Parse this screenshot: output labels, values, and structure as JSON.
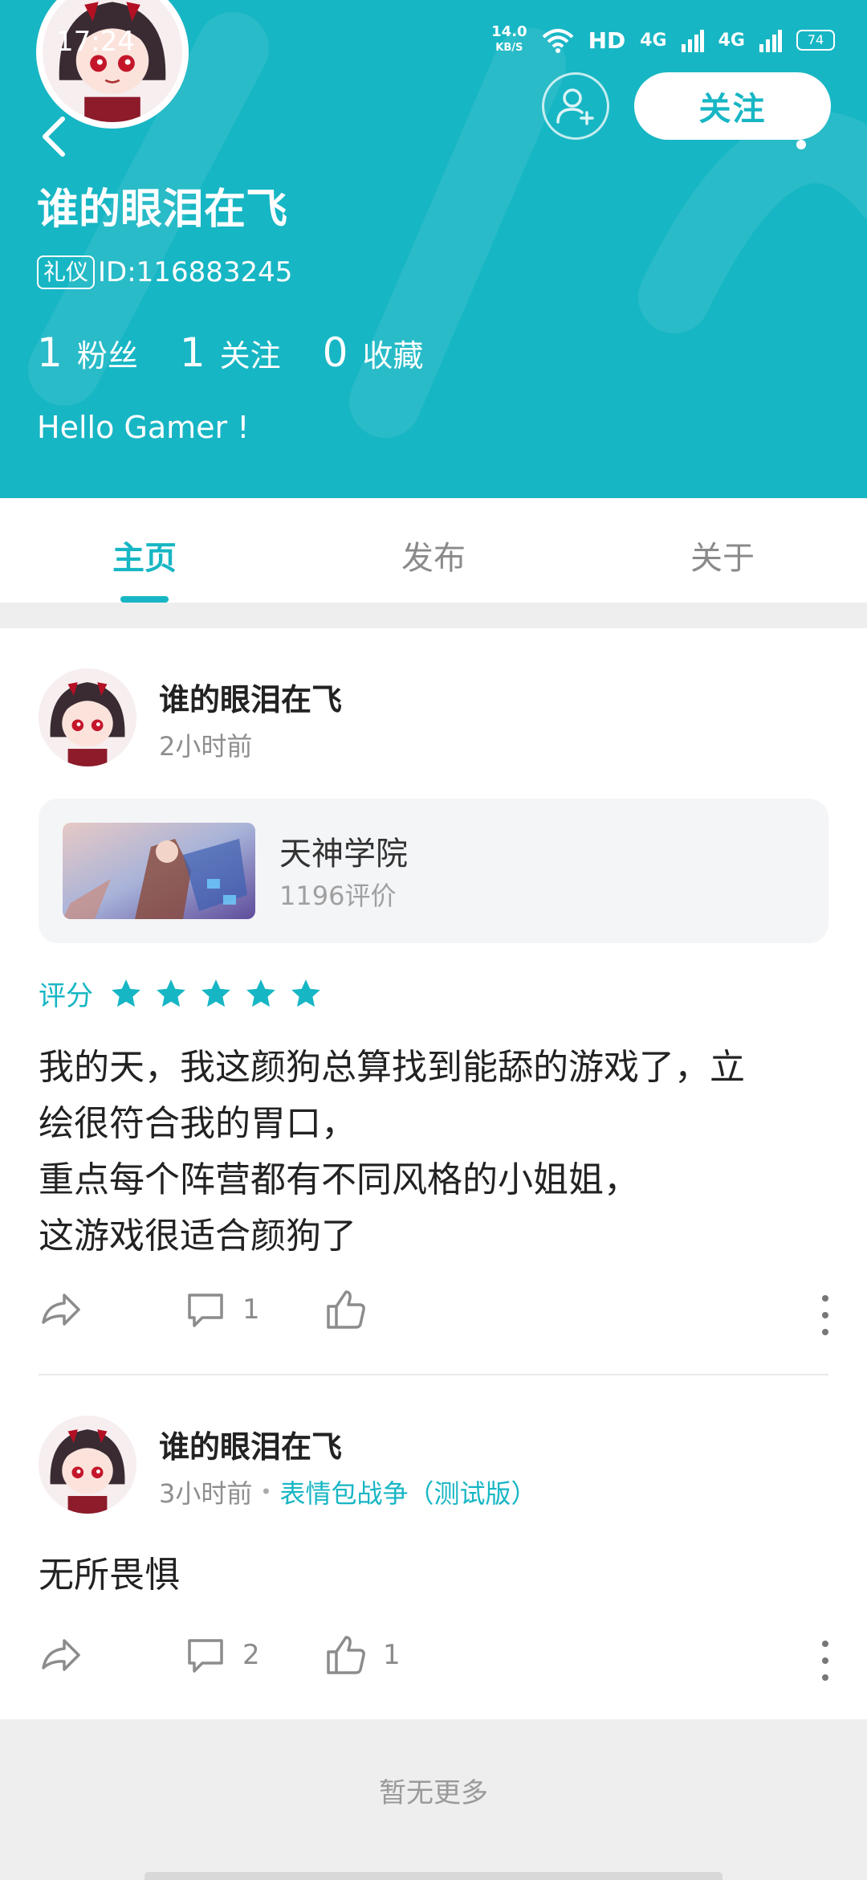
{
  "status_bar": {
    "time": "17:24",
    "speed_value": "14.0",
    "speed_unit": "KB/S",
    "hd_label": "HD",
    "signal1": "4G",
    "signal2": "4G",
    "battery": "74"
  },
  "header": {
    "follow_label": "关注",
    "username": "谁的眼泪在飞",
    "badge": "礼仪",
    "id_text": "ID:116883245",
    "bio": "Hello Gamer !",
    "stats": [
      {
        "num": "1",
        "label": "粉丝"
      },
      {
        "num": "1",
        "label": "关注"
      },
      {
        "num": "0",
        "label": "收藏"
      }
    ]
  },
  "tabs": [
    {
      "label": "主页",
      "active": true
    },
    {
      "label": "发布",
      "active": false
    },
    {
      "label": "关于",
      "active": false
    }
  ],
  "posts": [
    {
      "author": "谁的眼泪在飞",
      "time": "2小时前",
      "game_card": {
        "name": "天神学院",
        "reviews": "1196评价"
      },
      "rating_label": "评分",
      "rating": 5,
      "text_lines": [
        "我的天，我这颜狗总算找到能舔的游戏了，立",
        "绘很符合我的胃口，",
        "重点每个阵营都有不同风格的小姐姐，",
        "这游戏很适合颜狗了"
      ],
      "comments": "1",
      "likes": ""
    },
    {
      "author": "谁的眼泪在飞",
      "time": "3小时前",
      "game_link": "表情包战争（测试版）",
      "text_lines": [
        "无所畏惧"
      ],
      "comments": "2",
      "likes": "1"
    }
  ],
  "footer": {
    "text": "暂无更多"
  },
  "colors": {
    "accent": "#17b6c4",
    "background": "#ffffff",
    "band": "#eeeeee"
  }
}
